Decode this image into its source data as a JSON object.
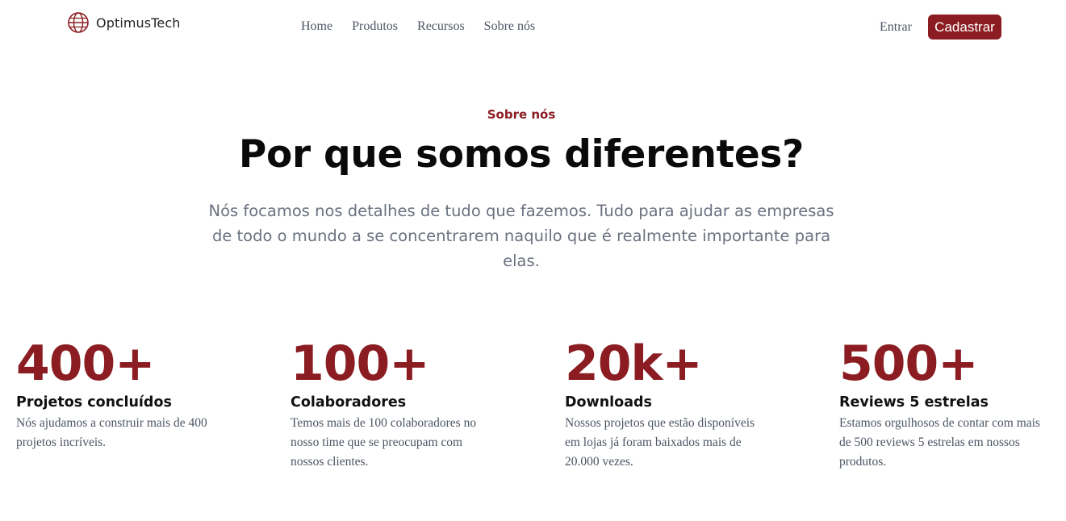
{
  "brand": {
    "name": "OptimusTech",
    "icon": "globe-icon"
  },
  "nav": {
    "links": [
      "Home",
      "Produtos",
      "Recursos",
      "Sobre nós"
    ],
    "login_label": "Entrar",
    "signup_label": "Cadastrar"
  },
  "hero": {
    "eyebrow": "Sobre nós",
    "headline": "Por que somos diferentes?",
    "subtitle": "Nós focamos nos detalhes de tudo que fazemos. Tudo para ajudar as empresas de todo o mundo a se concentrarem naquilo que é realmente importante para elas."
  },
  "stats": [
    {
      "value": "400+",
      "title": "Projetos concluídos",
      "description": "Nós ajudamos a construir mais de 400 projetos incríveis."
    },
    {
      "value": "100+",
      "title": "Colaboradores",
      "description": "Temos mais de 100 colaboradores no nosso time que se preocupam com nossos clientes."
    },
    {
      "value": "20k+",
      "title": "Downloads",
      "description": "Nossos projetos que estão disponíveis em lojas já foram baixados mais de 20.000 vezes."
    },
    {
      "value": "500+",
      "title": "Reviews 5 estrelas",
      "description": "Estamos orgulhosos de contar com mais de 500 reviews 5 estrelas em nossos produtos."
    }
  ],
  "colors": {
    "accent": "#8b1d22",
    "muted": "#6b7280",
    "text": "#0a0a0a"
  }
}
